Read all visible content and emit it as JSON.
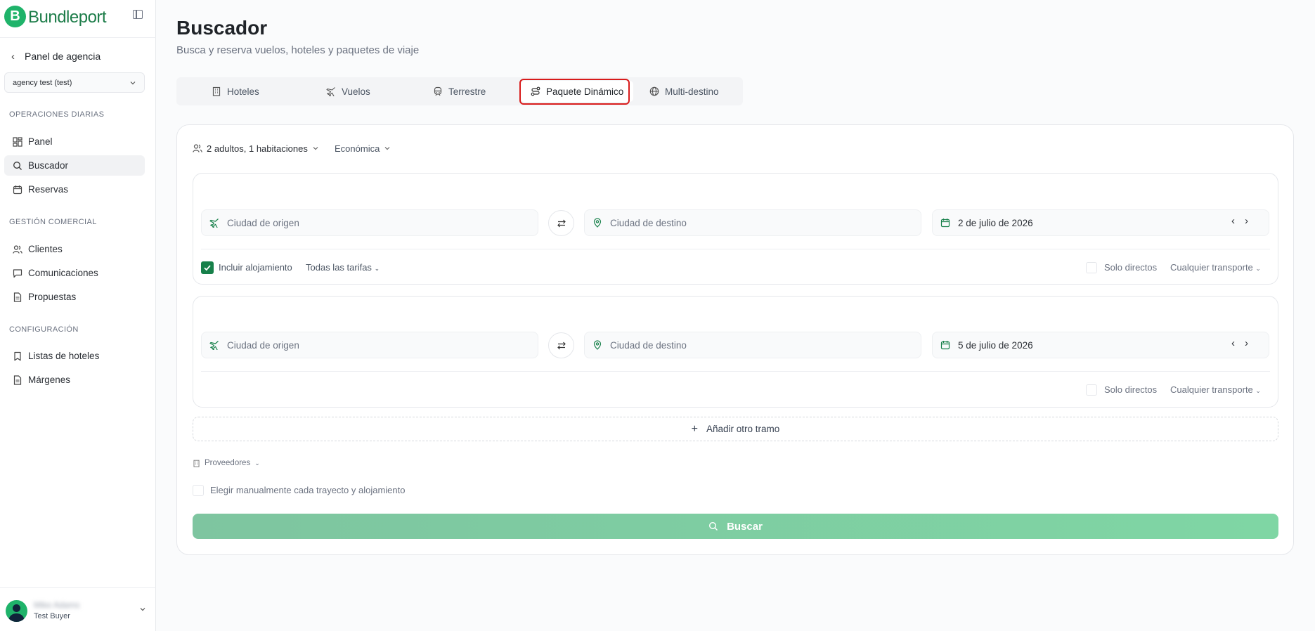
{
  "brand": {
    "name": "Bundleport",
    "logo_letter": "B",
    "color": "#1fb36a"
  },
  "sidebar": {
    "back_label": "Panel de agencia",
    "agency": "agency test (test)",
    "sections": {
      "daily": "OPERACIONES DIARIAS",
      "commercial": "GESTIÓN COMERCIAL",
      "config": "CONFIGURACIÓN"
    },
    "items": {
      "panel": "Panel",
      "buscador": "Buscador",
      "reservas": "Reservas",
      "clientes": "Clientes",
      "comunicaciones": "Comunicaciones",
      "propuestas": "Propuestas",
      "listas": "Listas de hoteles",
      "margenes": "Márgenes"
    },
    "active_item": "buscador",
    "user": {
      "name": "Mike Adams",
      "role": "Test Buyer"
    }
  },
  "main": {
    "title": "Buscador",
    "subtitle": "Busca y reserva vuelos, hoteles y paquetes de viaje",
    "tabs": {
      "hoteles": "Hoteles",
      "vuelos": "Vuelos",
      "terrestre": "Terrestre",
      "paquete": "Paquete Dinámico",
      "multi": "Multi-destino"
    },
    "active_tab": "paquete"
  },
  "search": {
    "passengers": "2 adultos, 1 habitaciones",
    "cabin": "Económica",
    "legs": [
      {
        "origin_placeholder": "Ciudad de origen",
        "destination_placeholder": "Ciudad de destino",
        "date": "2 de julio de 2026",
        "include_lodging": "Incluir alojamiento",
        "include_lodging_checked": true,
        "fares": "Todas las tarifas",
        "direct_only": "Solo directos",
        "transport": "Cualquier transporte"
      },
      {
        "origin_placeholder": "Ciudad de origen",
        "destination_placeholder": "Ciudad de destino",
        "date": "5 de julio de 2026",
        "direct_only": "Solo directos",
        "transport": "Cualquier transporte"
      }
    ],
    "add_leg": "Añadir otro tramo",
    "providers": "Proveedores",
    "manual_choice": "Elegir manualmente cada trayecto y alojamiento",
    "search_button": "Buscar"
  }
}
